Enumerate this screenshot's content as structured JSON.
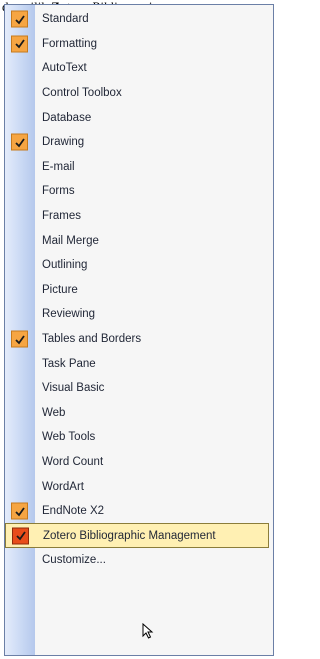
{
  "caption": {
    "prefix": "dan pilih",
    "app_name": "Zotero",
    "italic_rest": "Bibliograpi"
  },
  "menu": {
    "items": [
      {
        "label": "Standard",
        "checked": true
      },
      {
        "label": "Formatting",
        "checked": true
      },
      {
        "label": "AutoText",
        "checked": false
      },
      {
        "label": "Control Toolbox",
        "checked": false
      },
      {
        "label": "Database",
        "checked": false
      },
      {
        "label": "Drawing",
        "checked": true
      },
      {
        "label": "E-mail",
        "checked": false
      },
      {
        "label": "Forms",
        "checked": false
      },
      {
        "label": "Frames",
        "checked": false
      },
      {
        "label": "Mail Merge",
        "checked": false
      },
      {
        "label": "Outlining",
        "checked": false
      },
      {
        "label": "Picture",
        "checked": false
      },
      {
        "label": "Reviewing",
        "checked": false
      },
      {
        "label": "Tables and Borders",
        "checked": true
      },
      {
        "label": "Task Pane",
        "checked": false
      },
      {
        "label": "Visual Basic",
        "checked": false
      },
      {
        "label": "Web",
        "checked": false
      },
      {
        "label": "Web Tools",
        "checked": false
      },
      {
        "label": "Word Count",
        "checked": false
      },
      {
        "label": "WordArt",
        "checked": false
      },
      {
        "label": "EndNote X2",
        "checked": true
      },
      {
        "label": "Zotero Bibliographic Management",
        "checked": true,
        "highlighted": true
      },
      {
        "label": "Customize...",
        "checked": false
      }
    ]
  },
  "colors": {
    "check_fill": "#f6a542",
    "check_fill_highlighted": "#e84d1a",
    "highlight_bg": "#fff0b3"
  }
}
